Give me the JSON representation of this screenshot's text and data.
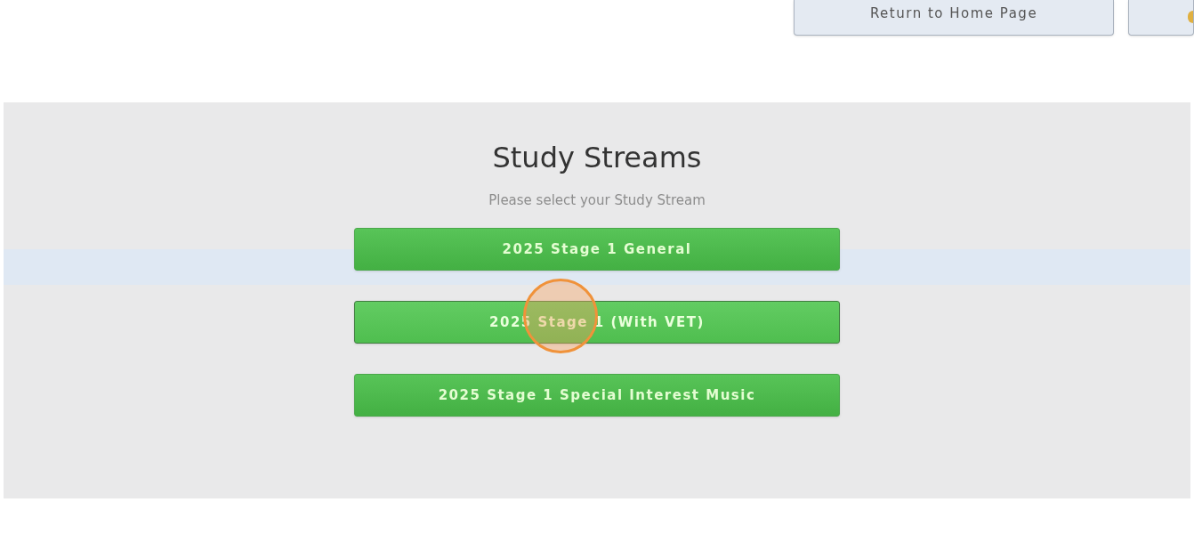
{
  "header": {
    "buttons": [
      {
        "label": "Return to Home Page"
      }
    ]
  },
  "panel": {
    "title": "Study Streams",
    "subtitle": "Please select your Study Stream",
    "streams": [
      {
        "label": "2025 Stage 1 General",
        "hovered": false
      },
      {
        "label": "2025 Stage 1 (With VET)",
        "hovered": true
      },
      {
        "label": "2025 Stage 1 Special Interest Music",
        "hovered": false
      }
    ]
  }
}
